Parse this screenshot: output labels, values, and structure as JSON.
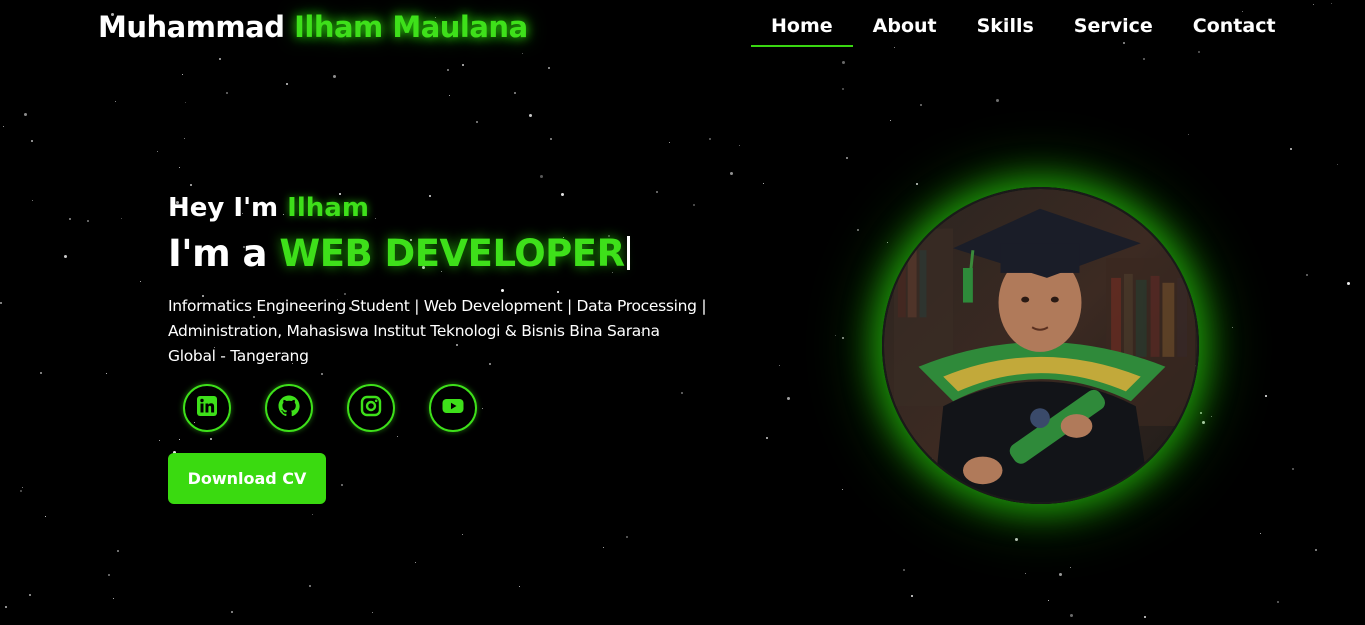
{
  "header": {
    "logo_first": "Muhammad ",
    "logo_accent": "Ilham Maulana",
    "nav": [
      {
        "label": "Home",
        "active": true
      },
      {
        "label": "About",
        "active": false
      },
      {
        "label": "Skills",
        "active": false
      },
      {
        "label": "Service",
        "active": false
      },
      {
        "label": "Contact",
        "active": false
      }
    ]
  },
  "hero": {
    "greeting_prefix": "Hey I'm ",
    "greeting_name": "Ilham",
    "role_prefix": "I'm a ",
    "role_accent": "WEB DEVELOPER",
    "description": "Informatics Engineering Student | Web Development | Data Processing | Administration, Mahasiswa Institut Teknologi & Bisnis Bina Sarana Global - Tangerang",
    "socials": [
      {
        "icon": "linkedin-icon"
      },
      {
        "icon": "github-icon"
      },
      {
        "icon": "instagram-icon"
      },
      {
        "icon": "youtube-icon"
      }
    ],
    "cv_button": "Download CV"
  },
  "colors": {
    "accent": "#3ee01a",
    "background": "#000000"
  }
}
